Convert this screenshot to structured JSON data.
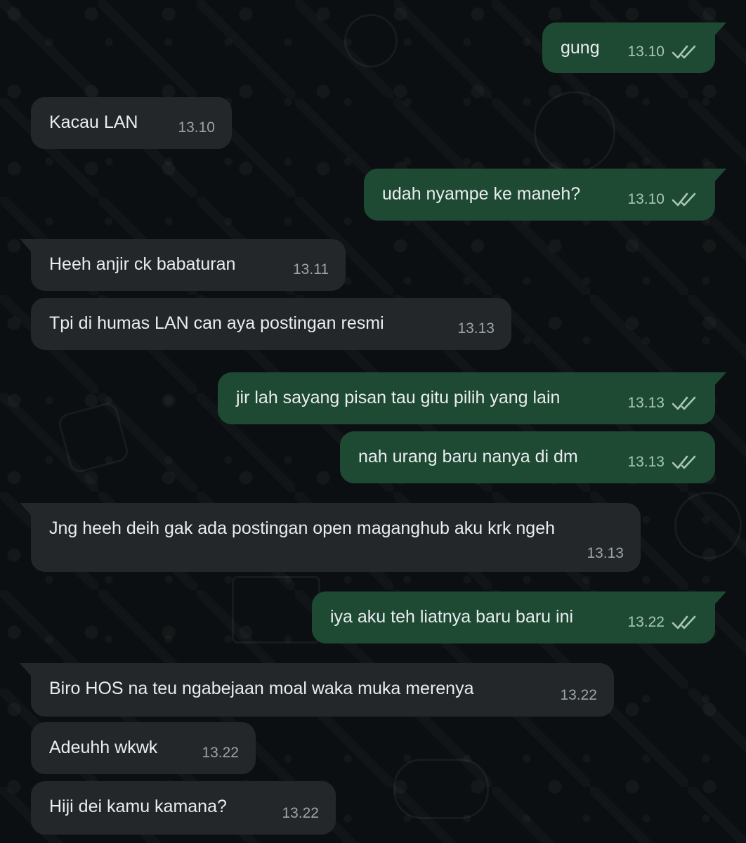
{
  "messages": [
    {
      "dir": "out",
      "text": "gung",
      "time": "13.10",
      "status": "read-double-check-icon"
    },
    {
      "dir": "in",
      "text": "Kacau LAN",
      "time": "13.10"
    },
    {
      "dir": "out",
      "text": "udah nyampe ke maneh?",
      "time": "13.10",
      "status": "read-double-check-icon"
    },
    {
      "dir": "in",
      "text": "Heeh anjir ck babaturan",
      "time": "13.11"
    },
    {
      "dir": "in",
      "text": "Tpi di humas LAN can aya postingan resmi",
      "time": "13.13"
    },
    {
      "dir": "out",
      "text": "jir lah sayang pisan tau gitu pilih yang lain",
      "time": "13.13",
      "status": "read-double-check-icon"
    },
    {
      "dir": "out",
      "text": "nah urang baru nanya di dm",
      "time": "13.13",
      "status": "read-double-check-icon"
    },
    {
      "dir": "in",
      "text": "Jng heeh deih gak ada postingan open maganghub aku krk ngeh",
      "time": "13.13"
    },
    {
      "dir": "out",
      "text": "iya aku teh liatnya baru baru ini",
      "time": "13.22",
      "status": "read-double-check-icon"
    },
    {
      "dir": "in",
      "text": "Biro HOS na teu ngabejaan moal waka muka merenya",
      "time": "13.22"
    },
    {
      "dir": "in",
      "text": "Adeuhh wkwk",
      "time": "13.22"
    },
    {
      "dir": "in",
      "text": "Hiji dei kamu kamana?",
      "time": "13.22"
    }
  ],
  "colors": {
    "background": "#0b0d0f",
    "incoming_bubble": "#232729",
    "outgoing_bubble": "#1e4a34",
    "text": "#e9edef",
    "timestamp": "#9aa4a8"
  }
}
